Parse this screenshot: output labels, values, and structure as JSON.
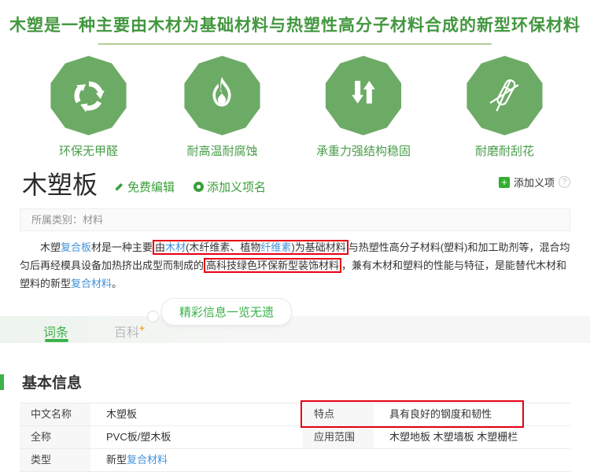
{
  "colors": {
    "brand_green": "#43973f",
    "rule_green": "#b7cd97",
    "icon_green": "#6cab66",
    "label_green": "#4a9d4a",
    "link_green": "#38a038",
    "tab_green": "#3cb24b",
    "link_blue": "#4292da",
    "highlight_red": "#e60012",
    "plus_orange": "#f6a623"
  },
  "banner": {
    "title": "木塑是一种主要由木材为基础材料与热塑性高分子材料合成的新型环保材料"
  },
  "features": [
    {
      "icon": "recycle-icon",
      "label": "环保无甲醛"
    },
    {
      "icon": "flame-icon",
      "label": "耐高温耐腐蚀"
    },
    {
      "icon": "arrows-icon",
      "label": "承重力强结构稳固"
    },
    {
      "icon": "no-scratch-icon",
      "label": "耐磨耐刮花"
    }
  ],
  "entry": {
    "title": "木塑板",
    "edit_link": "免费编辑",
    "add_alias_link": "添加义项名",
    "add_meaning_link": "添加义项",
    "plus_glyph": "+",
    "help_glyph": "?",
    "category": "所属类别：材料"
  },
  "summary": {
    "segments": [
      {
        "t": "text",
        "v": "木塑"
      },
      {
        "t": "link",
        "v": "复合板"
      },
      {
        "t": "text",
        "v": "材是一种主要"
      },
      {
        "t": "box",
        "segments": [
          {
            "t": "text",
            "v": "由"
          },
          {
            "t": "link",
            "v": "木材"
          },
          {
            "t": "text",
            "v": "(木纤维素、植物"
          },
          {
            "t": "link",
            "v": "纤维素"
          },
          {
            "t": "text",
            "v": ")为基础材料"
          }
        ]
      },
      {
        "t": "text",
        "v": "与热塑性高分子材料(塑料)和加工助剂等，混合均匀后再经模具设备加热挤出成型而制成的"
      },
      {
        "t": "box",
        "segments": [
          {
            "t": "text",
            "v": "高科技绿色环保新型装饰材料"
          }
        ]
      },
      {
        "t": "text",
        "v": "，兼有木材和塑料的性能与特征，是能替代木材和塑料的新型"
      },
      {
        "t": "link",
        "v": "复合材料"
      },
      {
        "t": "text",
        "v": "。"
      }
    ]
  },
  "promo": {
    "bubble_label": "精彩信息一览无遗"
  },
  "tabs": [
    {
      "label": "词条",
      "active": true
    },
    {
      "label": "百科",
      "sup": "+",
      "active": false
    }
  ],
  "basic_info": {
    "heading": "基本信息",
    "rows": [
      [
        {
          "label": "中文名称",
          "value": [
            {
              "t": "text",
              "v": "木塑板"
            }
          ]
        },
        {
          "label": "特点",
          "value": [
            {
              "t": "text",
              "v": "具有良好的钢度和韧性"
            }
          ],
          "highlighted": true
        }
      ],
      [
        {
          "label": "全称",
          "value": [
            {
              "t": "text",
              "v": "PVC板/塑木板"
            }
          ]
        },
        {
          "label": "应用范围",
          "value": [
            {
              "t": "text",
              "v": "木塑地板 木塑墙板 木塑栅栏"
            }
          ]
        }
      ],
      [
        {
          "label": "类型",
          "value": [
            {
              "t": "text",
              "v": "新型"
            },
            {
              "t": "link",
              "v": "复合材料"
            }
          ]
        },
        null
      ]
    ]
  }
}
